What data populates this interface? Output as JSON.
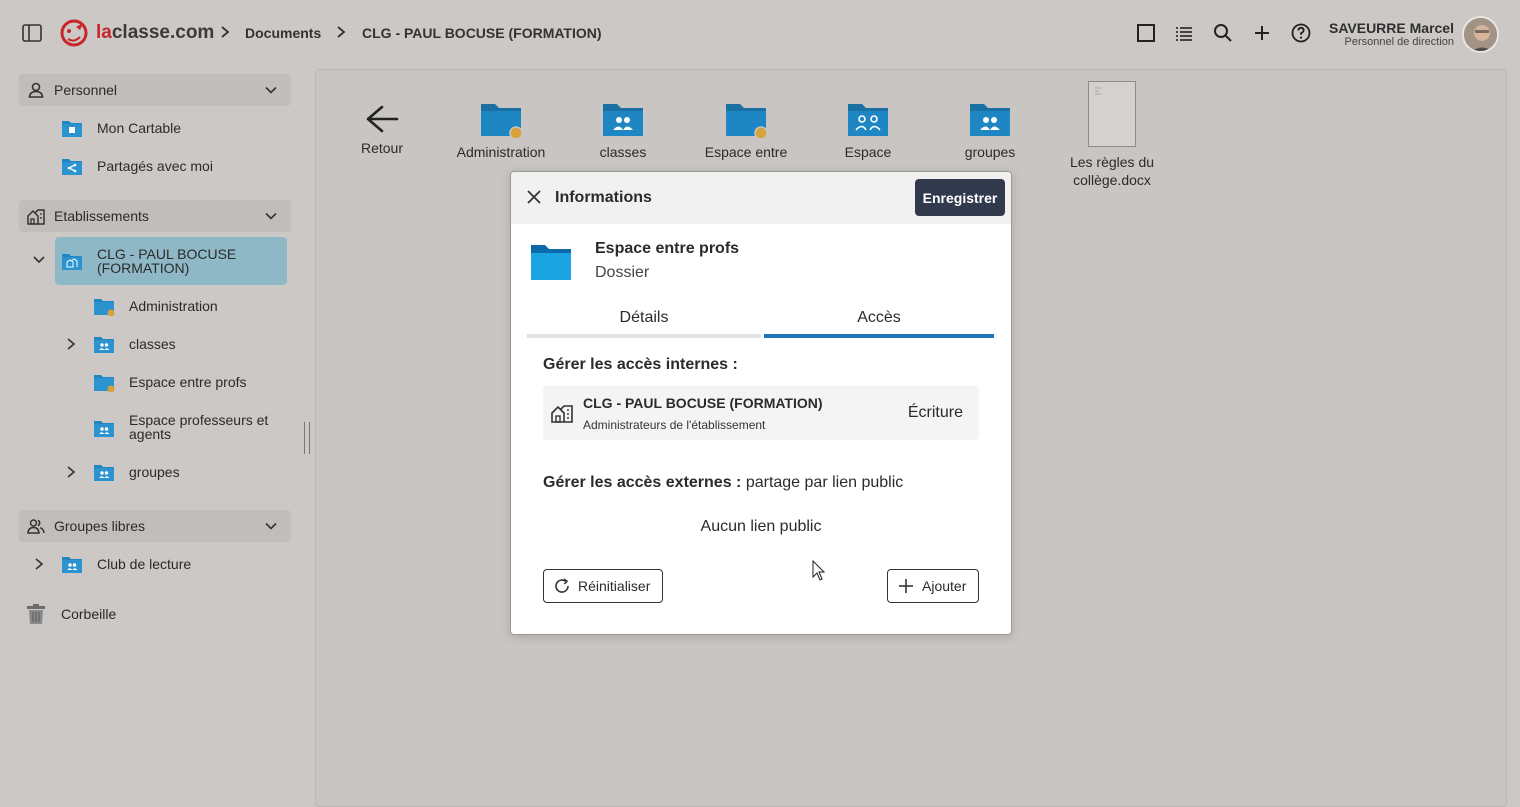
{
  "header": {
    "brand": {
      "la": "la",
      "rest": "classe.com"
    },
    "breadcrumbs": [
      "Documents",
      "CLG - PAUL BOCUSE (FORMATION)"
    ],
    "user": {
      "name": "SAVEURRE Marcel",
      "role": "Personnel de direction"
    }
  },
  "sidebar": {
    "personnel": {
      "label": "Personnel",
      "items": [
        "Mon Cartable",
        "Partagés avec moi"
      ]
    },
    "etablissements": {
      "label": "Etablissements",
      "school": "CLG - PAUL BOCUSE (FORMATION)",
      "items": [
        "Administration",
        "classes",
        "Espace entre profs",
        "Espace professeurs et agents",
        "groupes"
      ]
    },
    "groupes_libres": {
      "label": "Groupes libres",
      "items": [
        "Club de lecture"
      ]
    },
    "trash": "Corbeille"
  },
  "main": {
    "back_label": "Retour",
    "items": [
      "Administration",
      "classes",
      "Espace entre",
      "Espace",
      "groupes",
      "Les règles du collège.docx"
    ]
  },
  "dialog": {
    "title": "Informations",
    "save_label": "Enregistrer",
    "item_name": "Espace entre profs",
    "item_type": "Dossier",
    "tabs": [
      "Détails",
      "Accès"
    ],
    "active_tab": "Accès",
    "internal_title": "Gérer les accès internes :",
    "access": {
      "name": "CLG - PAUL BOCUSE (FORMATION)",
      "sub": "Administrateurs de l'établissement",
      "permission": "Écriture"
    },
    "external_title": "Gérer les accès externes :",
    "external_sub": "partage par lien public",
    "no_link": "Aucun lien public",
    "reset_label": "Réinitialiser",
    "add_label": "Ajouter"
  },
  "colors": {
    "folder": "#1f86c4",
    "folder_dark": "#1a6fa3",
    "accent_badge": "#d9a13a",
    "selected_bg": "#8eb8c5",
    "save_btn": "#303a4c",
    "tab_active": "#2074ba",
    "brand_red": "#c8262b"
  }
}
